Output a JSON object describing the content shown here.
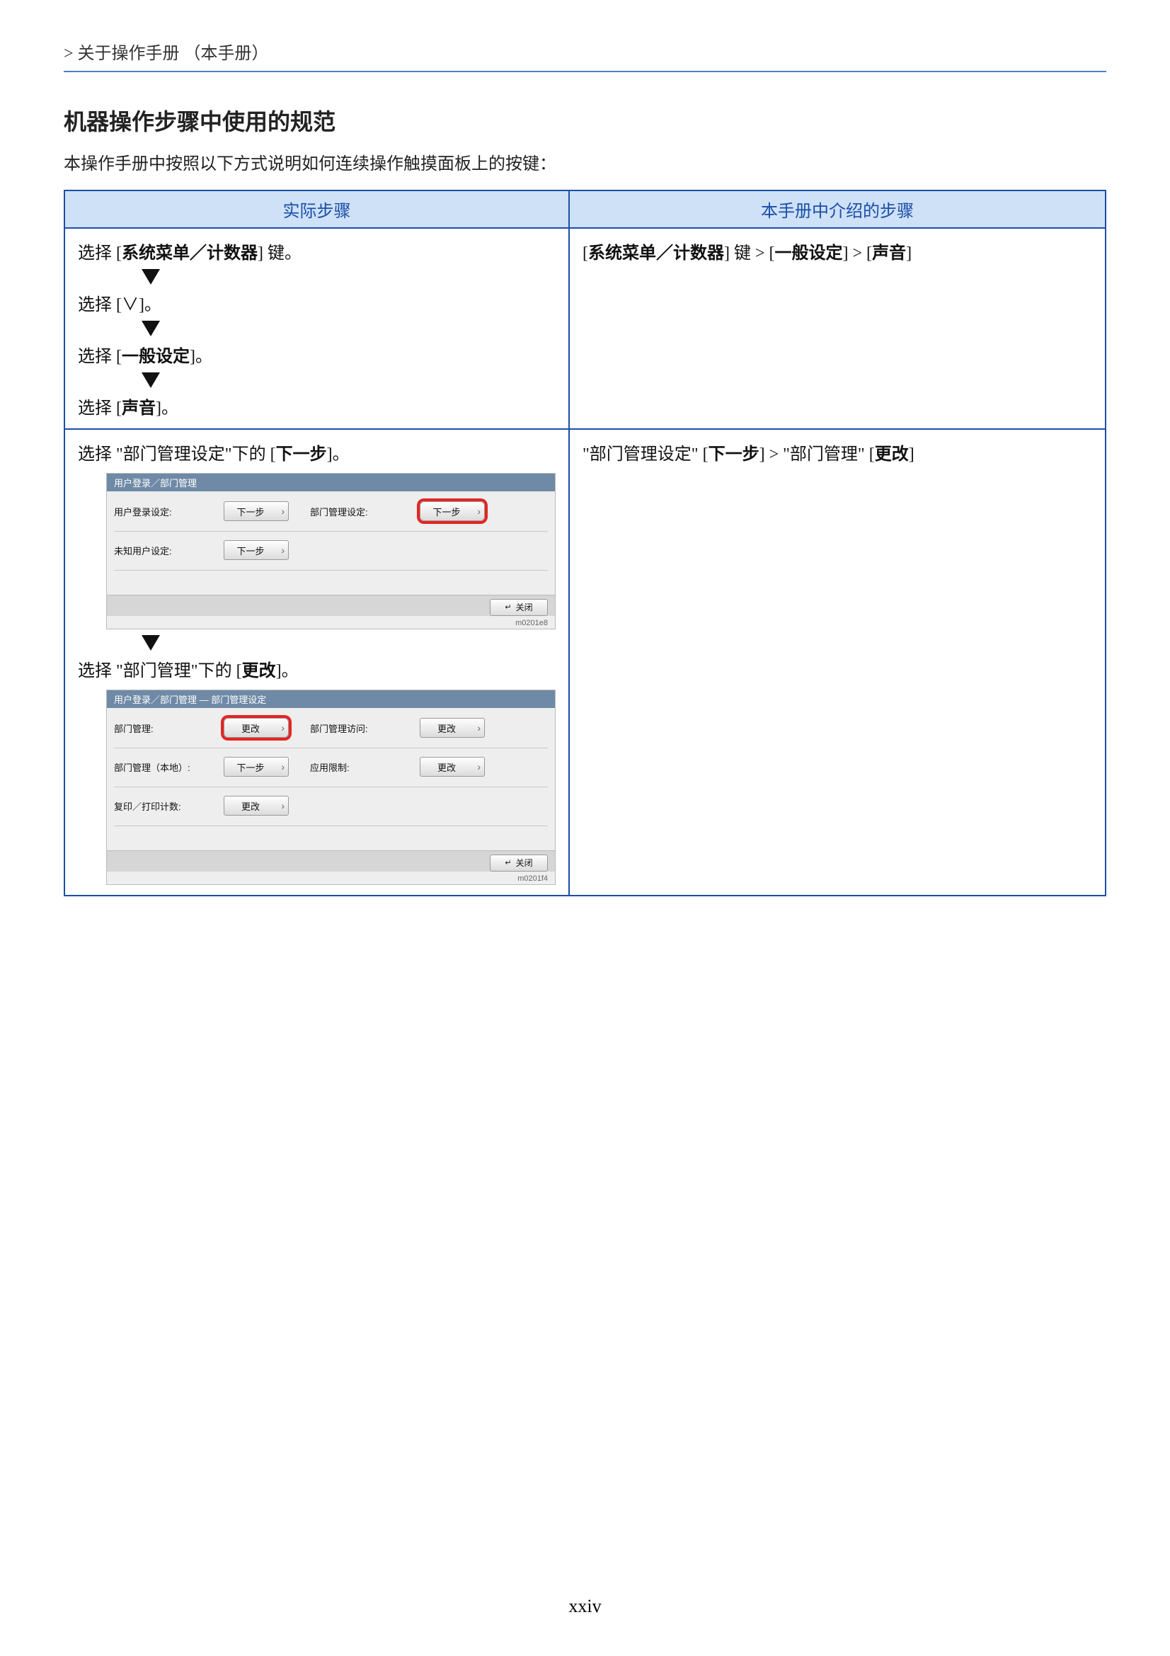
{
  "breadcrumb": "> 关于操作手册 （本手册）",
  "section": {
    "title": "机器操作步骤中使用的规范",
    "desc": "本操作手册中按照以下方式说明如何连续操作触摸面板上的按键："
  },
  "table": {
    "header_left": "实际步骤",
    "header_right": "本手册中介绍的步骤",
    "row1": {
      "left": {
        "step1_prefix": "选择 [",
        "step1_bold": "系统菜单／计数器",
        "step1_suffix": "] 键。",
        "step2": "选择 [∨]。",
        "step3_prefix": "选择 [",
        "step3_bold": "一般设定",
        "step3_suffix": "]。",
        "step4_prefix": "选择 [",
        "step4_bold": "声音",
        "step4_suffix": "]。"
      },
      "right": {
        "prefix": "[",
        "bold1": "系统菜单／计数器",
        "mid1": "] 键 > [",
        "bold2": "一般设定",
        "mid2": "] > [",
        "bold3": "声音",
        "suffix": "]"
      }
    },
    "row2": {
      "left": {
        "step1_prefix": "选择 \"部门管理设定\"下的 [",
        "step1_bold": "下一步",
        "step1_suffix": "]。",
        "step2_prefix": "选择 \"部门管理\"下的 [",
        "step2_bold": "更改",
        "step2_suffix": "]。"
      },
      "right": {
        "prefix": "\"部门管理设定\" [",
        "bold1": "下一步",
        "mid": "] > \"部门管理\" [",
        "bold2": "更改",
        "suffix": "]"
      }
    }
  },
  "panel1": {
    "title": "用户登录／部门管理",
    "label_userlogin": "用户登录设定:",
    "btn_userlogin": "下一步",
    "label_deptmgmt": "部门管理设定:",
    "btn_deptmgmt": "下一步",
    "label_unknown": "未知用户设定:",
    "btn_unknown": "下一步",
    "close": "关闭",
    "code": "m0201e8"
  },
  "panel2": {
    "title": "用户登录／部门管理 — 部门管理设定",
    "label_dept": "部门管理:",
    "btn_dept": "更改",
    "label_deptaccess": "部门管理访问:",
    "btn_deptaccess": "更改",
    "label_deptlocal": "部门管理（本地）:",
    "btn_deptlocal": "下一步",
    "label_applimit": "应用限制:",
    "btn_applimit": "更改",
    "label_copy": "复印／打印计数:",
    "btn_copy": "更改",
    "close": "关闭",
    "code": "m0201f4"
  },
  "page_number": "xxiv"
}
